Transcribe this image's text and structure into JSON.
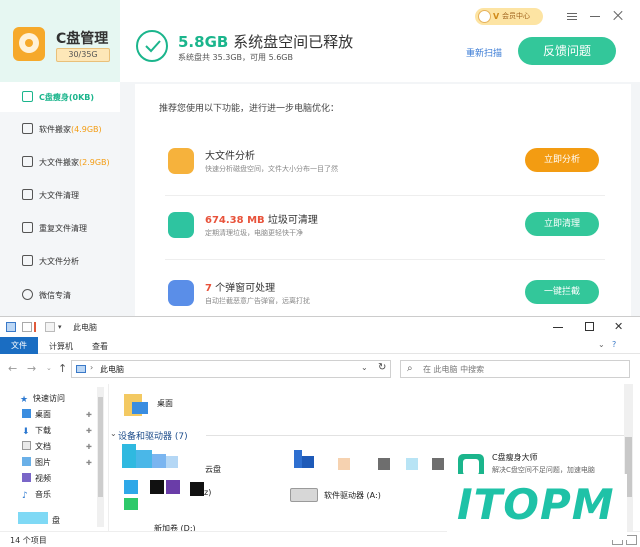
{
  "app": {
    "title": "C盘管理",
    "capacity": "30/35G",
    "headline_size": "5.8GB",
    "headline_text": "系统盘空间已释放",
    "subline": "系统盘共 35.3GB，可用 5.6GB",
    "rescan": "重新扫描",
    "feedback": "反馈问题",
    "vip": "会员中心",
    "vip_mark": "V",
    "accent": "#1bb58c",
    "nav": [
      {
        "label": "C盘瘦身",
        "size": "(0KB)"
      },
      {
        "label": "软件搬家",
        "size": "(4.9GB)"
      },
      {
        "label": "大文件搬家",
        "size": "(2.9GB)"
      },
      {
        "label": "大文件清理",
        "size": ""
      },
      {
        "label": "重复文件清理",
        "size": ""
      },
      {
        "label": "大文件分析",
        "size": ""
      },
      {
        "label": "微信专清",
        "size": ""
      }
    ],
    "hint": "推荐您使用以下功能，进行进一步电脑优化：",
    "cards": [
      {
        "highlight": "",
        "title": "大文件分析",
        "desc": "快速分析磁盘空间，文件大小分布一目了然",
        "button": "立即分析",
        "color": "#f39c12"
      },
      {
        "highlight": "674.38 MB",
        "title": " 垃圾可清理",
        "desc": "定期清理垃圾，电脑更轻快干净",
        "button": "立即清理",
        "color": "#33c79a"
      },
      {
        "highlight": "7",
        "title": " 个弹窗可处理",
        "desc": "自动拦截恶意广告弹窗，远离打扰",
        "button": "一键拦截",
        "color": "#33c79a"
      }
    ]
  },
  "explorer": {
    "title": "此电脑",
    "tabs": [
      "文件",
      "计算机",
      "查看"
    ],
    "address": "此电脑",
    "search_placeholder": "在 此电脑 中搜索",
    "tree": [
      "快速访问",
      "桌面",
      "下载",
      "文档",
      "图片",
      "视频",
      "音乐",
      "盘"
    ],
    "desktop": "桌面",
    "section": "设备和驱动器 (7)",
    "cloud": "云盘",
    "drive": "软件驱动器 (A:)",
    "app_name": "C盘瘦身大师",
    "app_desc": "解决C盘空间不足问题，加速电脑",
    "partial_drive": "新加卷 (D:)",
    "partial_item": "z)",
    "status": "14 个项目",
    "watermark": "ITOPM"
  }
}
